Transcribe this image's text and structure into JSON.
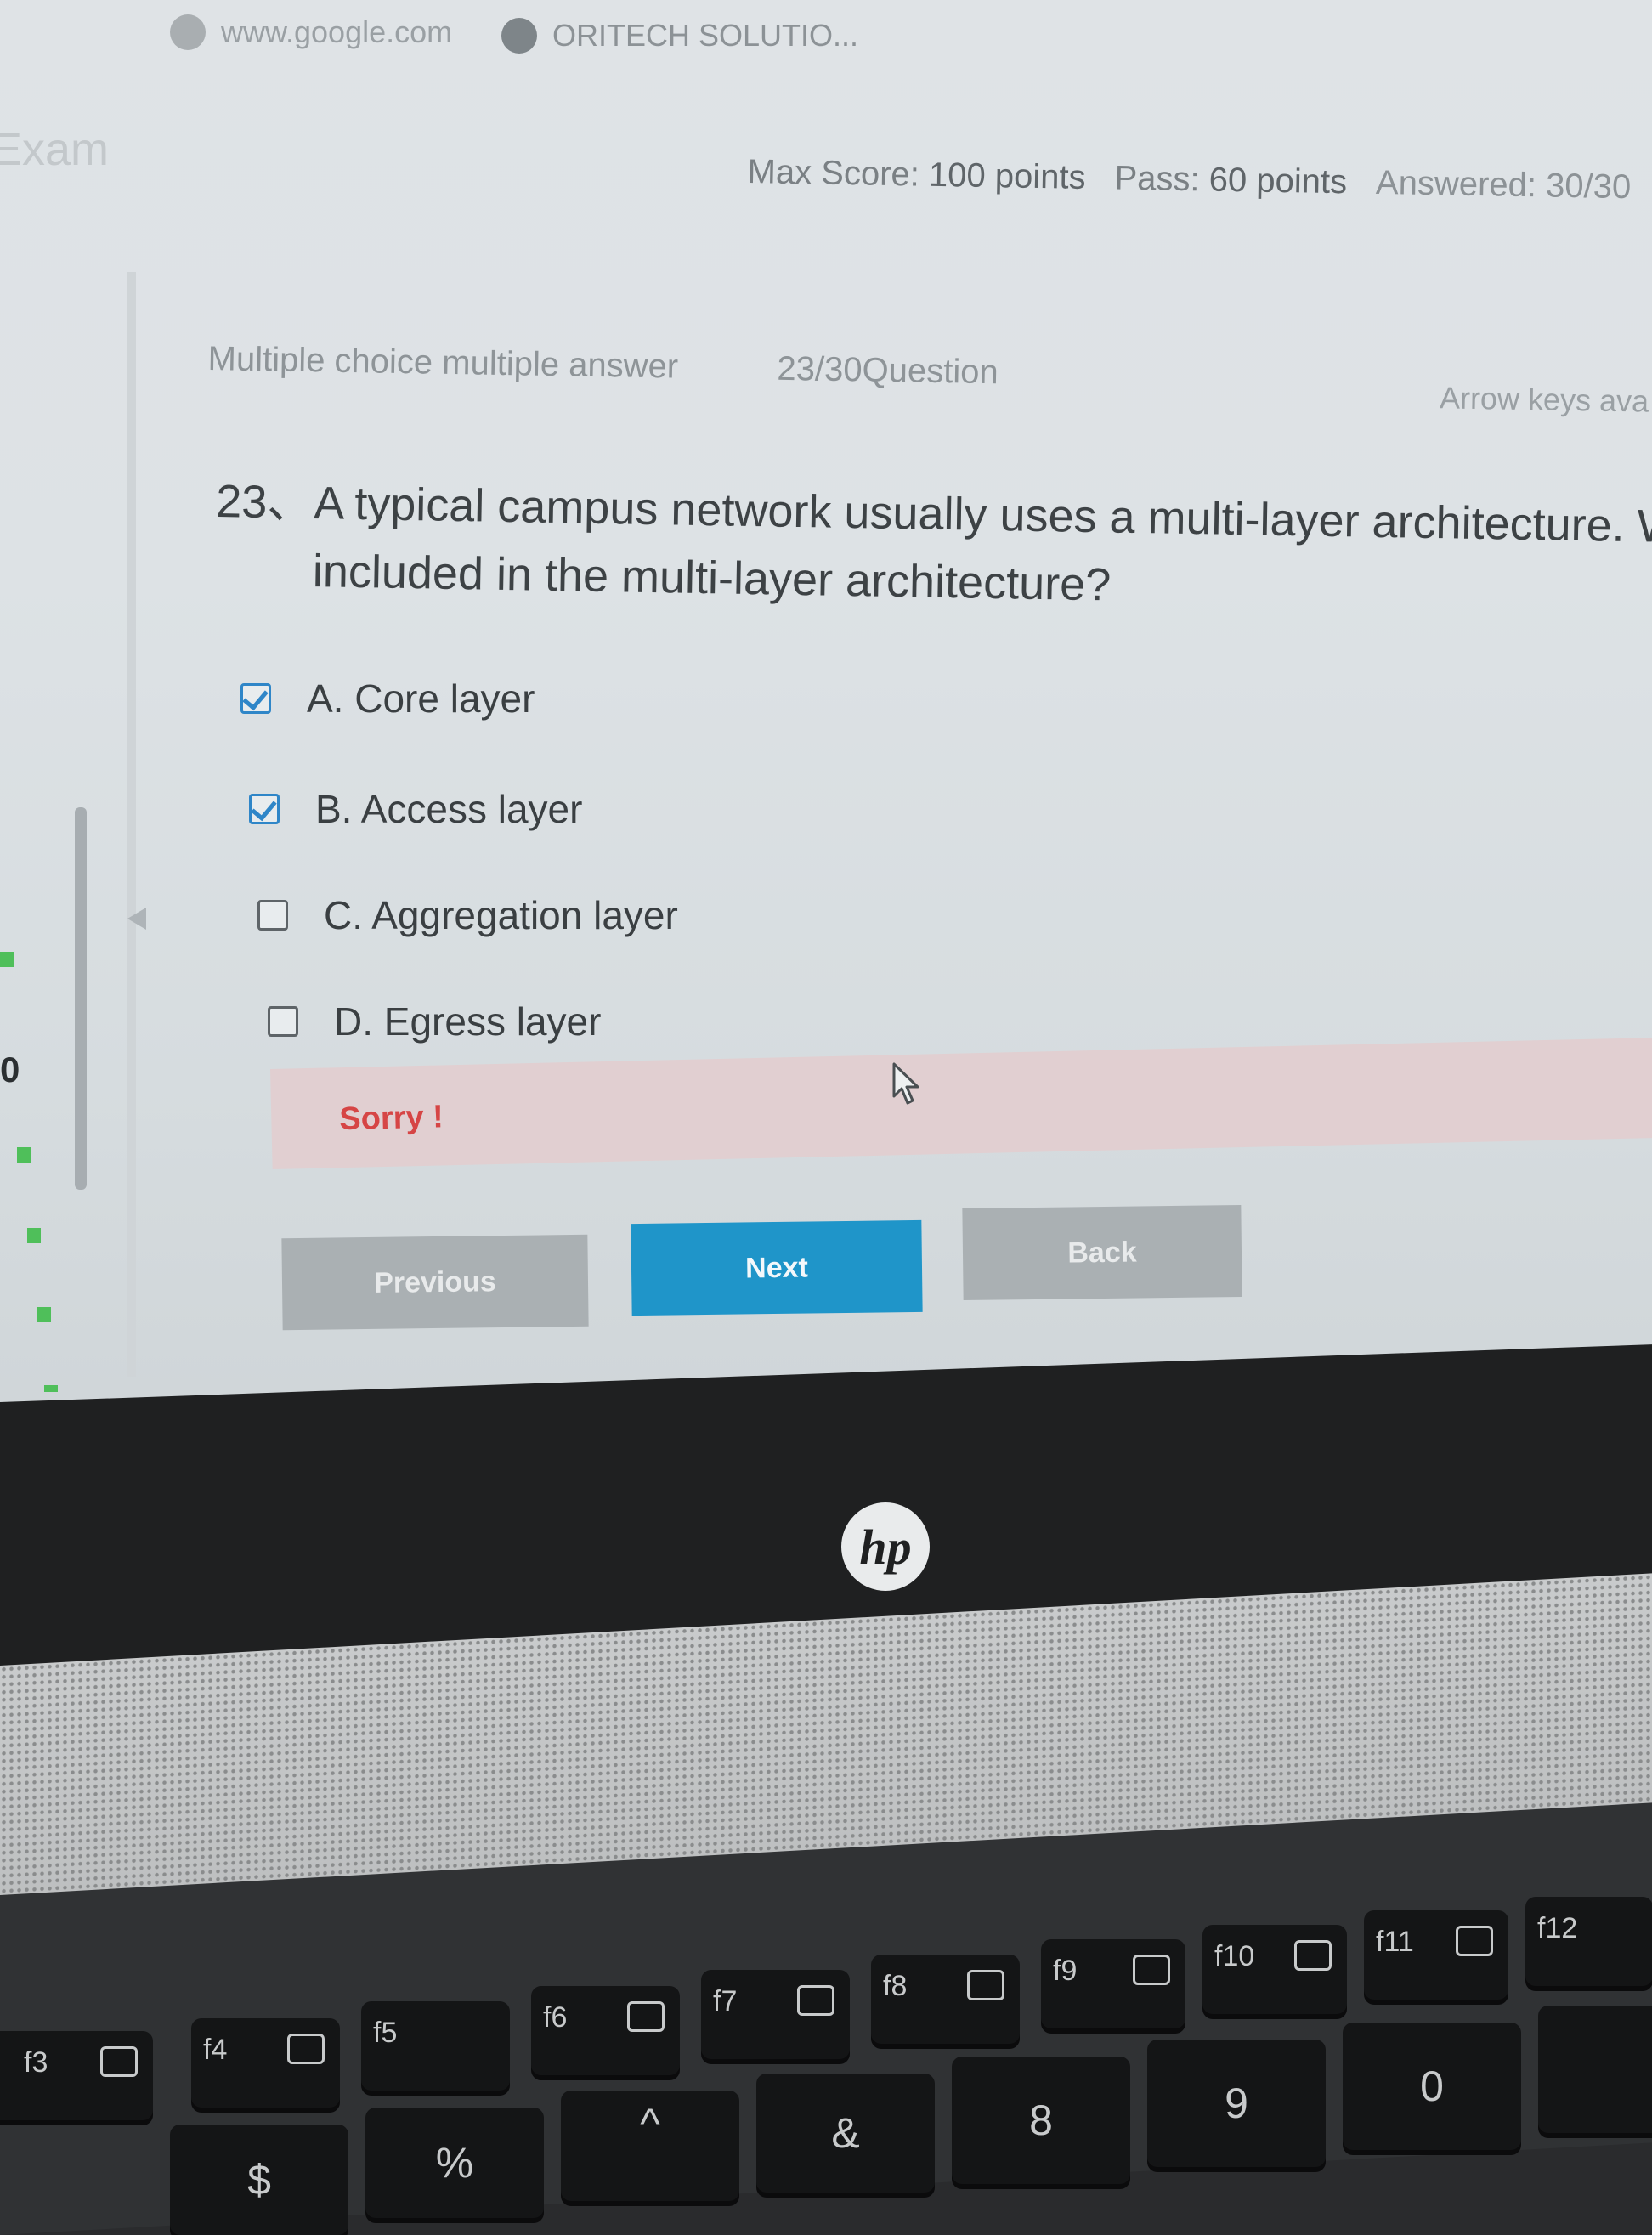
{
  "browser": {
    "tabs": [
      {
        "label": "www.google.com",
        "icon": "globe-icon"
      },
      {
        "label": "ORITECH SOLUTIO...",
        "icon": "globe-icon"
      }
    ]
  },
  "header": {
    "app_title": "Exam",
    "max_score_label": "Max Score:",
    "max_score_value": "100 points",
    "pass_label": "Pass:",
    "pass_value": "60 points",
    "answered_label": "Answered:",
    "answered_value": "30/30"
  },
  "sidebar": {
    "visible_number": "0"
  },
  "question": {
    "type": "Multiple choice multiple answer",
    "counter": "23/30Question",
    "hint": "Arrow keys ava",
    "number": "23、",
    "text": "A typical campus network usually uses a multi-layer architecture. Whic\nincluded in the multi-layer architecture?",
    "options": [
      {
        "label": "A. Core layer",
        "checked": true
      },
      {
        "label": "B. Access  layer",
        "checked": true
      },
      {
        "label": "C. Aggregation layer",
        "checked": false
      },
      {
        "label": "D. Egress layer",
        "checked": false
      }
    ]
  },
  "feedback": {
    "message": "Sorry !",
    "color": "#d64545"
  },
  "buttons": {
    "previous": "Previous",
    "next": "Next",
    "back": "Back"
  },
  "colors": {
    "accent": "#1f95c9",
    "checkbox_checked": "#2f86c8",
    "sidebar_indicator": "#4fbf5a"
  },
  "laptop": {
    "brand_logo": "hp",
    "function_keys": [
      "f3",
      "f4",
      "f5",
      "f6",
      "f7",
      "f8",
      "f9",
      "f10",
      "f11",
      "f12"
    ],
    "number_row": [
      "$",
      "%",
      "^",
      "&",
      "8",
      "9",
      "0"
    ]
  }
}
